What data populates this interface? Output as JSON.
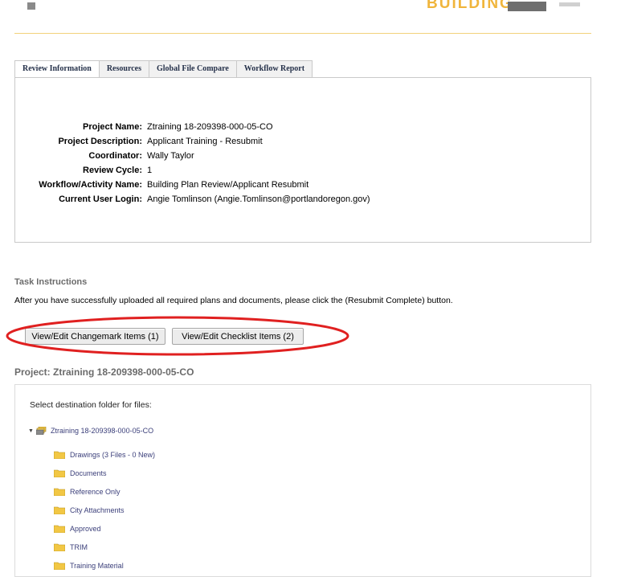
{
  "header": {
    "brand_text": "BUILDING"
  },
  "tabs": [
    {
      "label": "Review Information"
    },
    {
      "label": "Resources"
    },
    {
      "label": "Global File Compare"
    },
    {
      "label": "Workflow Report"
    }
  ],
  "review_info": {
    "rows": [
      {
        "label": "Project Name:",
        "value": "Ztraining 18-209398-000-05-CO"
      },
      {
        "label": "Project Description:",
        "value": "Applicant Training - Resubmit"
      },
      {
        "label": "Coordinator:",
        "value": "Wally Taylor"
      },
      {
        "label": "Review Cycle:",
        "value": "1"
      },
      {
        "label": "Workflow/Activity Name:",
        "value": "Building Plan Review/Applicant Resubmit"
      },
      {
        "label": "Current User Login:",
        "value": "Angie Tomlinson (Angie.Tomlinson@portlandoregon.gov)"
      }
    ]
  },
  "task": {
    "title": "Task Instructions",
    "text": "After you have successfully uploaded all required plans and documents, please click the (Resubmit Complete) button."
  },
  "buttons": {
    "changemark": "View/Edit Changemark Items (1)",
    "checklist": "View/Edit Checklist Items (2)"
  },
  "project_heading": "Project: Ztraining 18-209398-000-05-CO",
  "files": {
    "destination_label": "Select destination folder for files:",
    "root": "Ztraining 18-209398-000-05-CO",
    "folders": [
      "Drawings (3 Files - 0 New)",
      "Documents",
      "Reference Only",
      "City Attachments",
      "Approved",
      "TRIM",
      "Training Material"
    ]
  },
  "colors": {
    "brand": "#f0b53c",
    "annotation_circle": "#e02020",
    "folder": "#f2c744",
    "link_text": "#3b3f7a"
  }
}
